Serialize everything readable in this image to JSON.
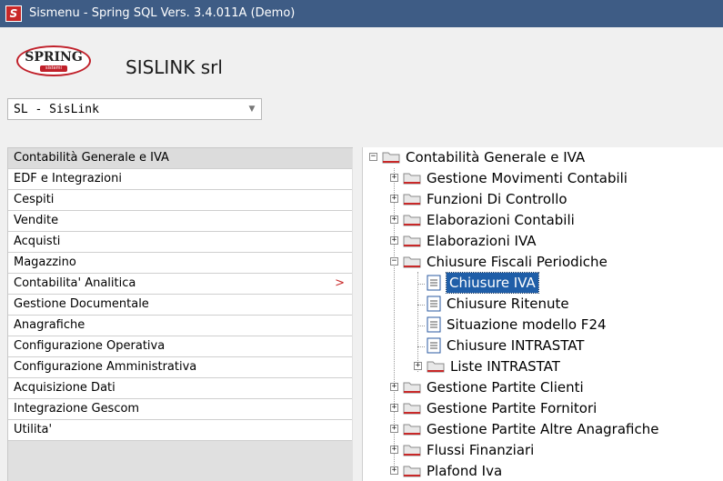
{
  "window": {
    "title": "Sismenu - Spring SQL Vers. 3.4.011A  (Demo)"
  },
  "logo": {
    "brand": "SPRING",
    "sub": "sistemi"
  },
  "company": "SISLINK srl",
  "company_select": {
    "value": "SL - SisLink"
  },
  "menu": [
    {
      "label": "Contabilità Generale e IVA",
      "selected": true
    },
    {
      "label": "EDF e Integrazioni"
    },
    {
      "label": "Cespiti"
    },
    {
      "label": "Vendite"
    },
    {
      "label": "Acquisti"
    },
    {
      "label": "Magazzino"
    },
    {
      "label": "Contabilita' Analitica",
      "submenu": ">"
    },
    {
      "label": "Gestione Documentale"
    },
    {
      "label": "Anagrafiche"
    },
    {
      "label": "Configurazione Operativa"
    },
    {
      "label": "Configurazione Amministrativa"
    },
    {
      "label": "Acquisizione Dati"
    },
    {
      "label": "Integrazione Gescom"
    },
    {
      "label": "Utilita'"
    }
  ],
  "tree": {
    "root": {
      "label": "Contabilità Generale e IVA",
      "toggle": "−"
    },
    "nodes": [
      {
        "label": "Gestione Movimenti Contabili",
        "toggle": "+"
      },
      {
        "label": "Funzioni Di Controllo",
        "toggle": "+"
      },
      {
        "label": "Elaborazioni Contabili",
        "toggle": "+"
      },
      {
        "label": "Elaborazioni IVA",
        "toggle": "+"
      },
      {
        "label": "Chiusure Fiscali Periodiche",
        "toggle": "−"
      },
      {
        "label": "Chiusure IVA",
        "selected": true
      },
      {
        "label": "Chiusure Ritenute"
      },
      {
        "label": "Situazione modello F24"
      },
      {
        "label": "Chiusure INTRASTAT"
      },
      {
        "label": "Liste INTRASTAT",
        "toggle": "+"
      },
      {
        "label": "Gestione Partite Clienti",
        "toggle": "+"
      },
      {
        "label": "Gestione Partite Fornitori",
        "toggle": "+"
      },
      {
        "label": "Gestione Partite Altre Anagrafiche",
        "toggle": "+"
      },
      {
        "label": "Flussi Finanziari",
        "toggle": "+"
      },
      {
        "label": "Plafond Iva",
        "toggle": "+"
      }
    ]
  },
  "colors": {
    "titlebar": "#3e5c85",
    "accent": "#c82828",
    "selection": "#1f5ea8"
  }
}
